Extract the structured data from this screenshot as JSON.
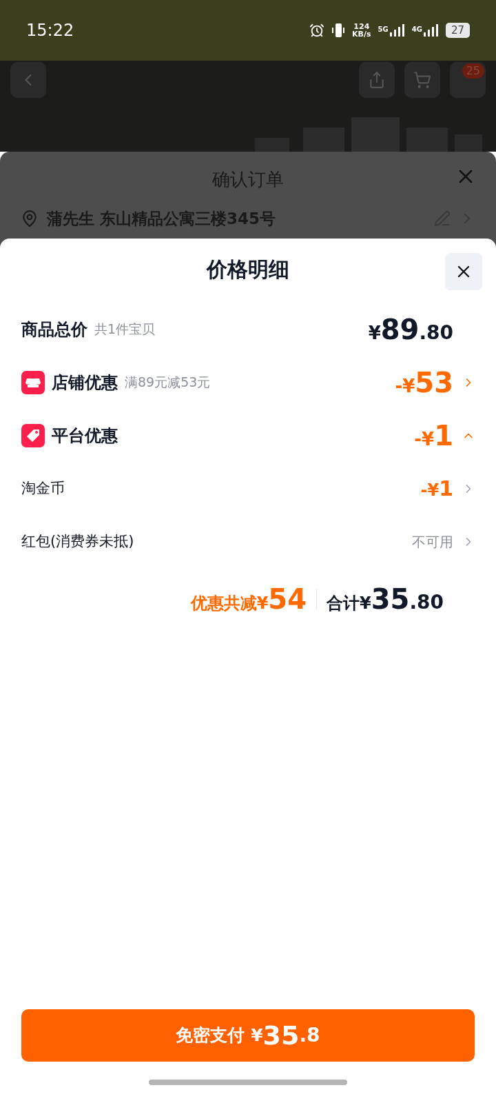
{
  "status_bar": {
    "time": "15:22",
    "speed_value": "124",
    "speed_unit": "KB/s",
    "networks": [
      "5G",
      "4G"
    ],
    "battery": "27"
  },
  "background_page": {
    "cart_badge": "25"
  },
  "order_sheet": {
    "title": "确认订单",
    "address": "蒲先生 东山精品公寓三楼345号"
  },
  "price_detail": {
    "title": "价格明细",
    "rows": [
      {
        "kind": "total",
        "label": "商品总价",
        "note": "共1件宝贝",
        "prefix": "¥",
        "integer": "89",
        "decimal": ".80"
      },
      {
        "kind": "store",
        "label": "店铺优惠",
        "note": "满89元减53元",
        "prefix": "-¥",
        "integer": "53",
        "expanded": false
      },
      {
        "kind": "platform",
        "label": "平台优惠",
        "prefix": "-¥",
        "integer": "1",
        "expanded": true
      },
      {
        "kind": "sub",
        "label": "淘金币",
        "prefix": "-¥",
        "integer": "1"
      },
      {
        "kind": "sub_status",
        "label": "红包(消费券未抵)",
        "status": "不可用"
      }
    ],
    "summary": {
      "discount_label": "优惠共减",
      "discount_prefix": "¥",
      "discount": "54",
      "total_label": "合计",
      "total_prefix": "¥",
      "total_integer": "35",
      "total_decimal": ".80"
    }
  },
  "pay_button": {
    "label": "免密支付",
    "prefix": "¥",
    "integer": "35",
    "decimal": ".8"
  }
}
